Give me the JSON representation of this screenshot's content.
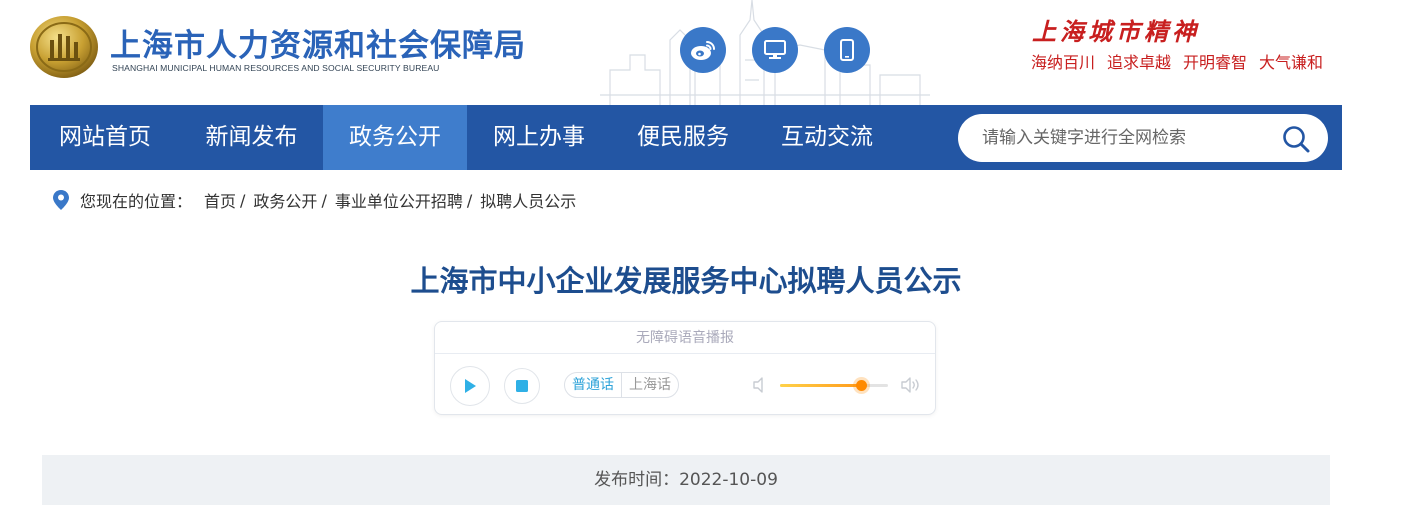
{
  "header": {
    "bureau_name_cn": "上海市人力资源和社会保障局",
    "bureau_name_en": "SHANGHAI MUNICIPAL HUMAN RESOURCES AND SOCIAL SECURITY BUREAU",
    "quick_icons": [
      "weibo-icon",
      "desktop-icon",
      "mobile-icon"
    ],
    "spirit_title": "上海城市精神",
    "spirit_mottos": [
      "海纳百川",
      "追求卓越",
      "开明睿智",
      "大气谦和"
    ]
  },
  "nav": {
    "items": [
      "网站首页",
      "新闻发布",
      "政务公开",
      "网上办事",
      "便民服务",
      "互动交流"
    ],
    "active_index": 2,
    "search_placeholder": "请输入关键字进行全网检索"
  },
  "breadcrumb": {
    "label": "您现在的位置：",
    "items": [
      "首页",
      "政务公开",
      "事业单位公开招聘",
      "拟聘人员公示"
    ]
  },
  "article": {
    "title": "上海市中小企业发展服务中心拟聘人员公示",
    "publish_time": "发布时间：2022-10-09"
  },
  "player": {
    "header": "无障碍语音播报",
    "languages": [
      "普通话",
      "上海话"
    ],
    "selected_language": "普通话",
    "volume": 0.75
  },
  "colors": {
    "nav_bg": "#2356a4",
    "nav_active": "#3f7dcc",
    "title_blue": "#1d4d8e",
    "spirit_red": "#c81f1f",
    "accent_cyan": "#2fa3d9",
    "volume_orange": "#ff8a00"
  }
}
